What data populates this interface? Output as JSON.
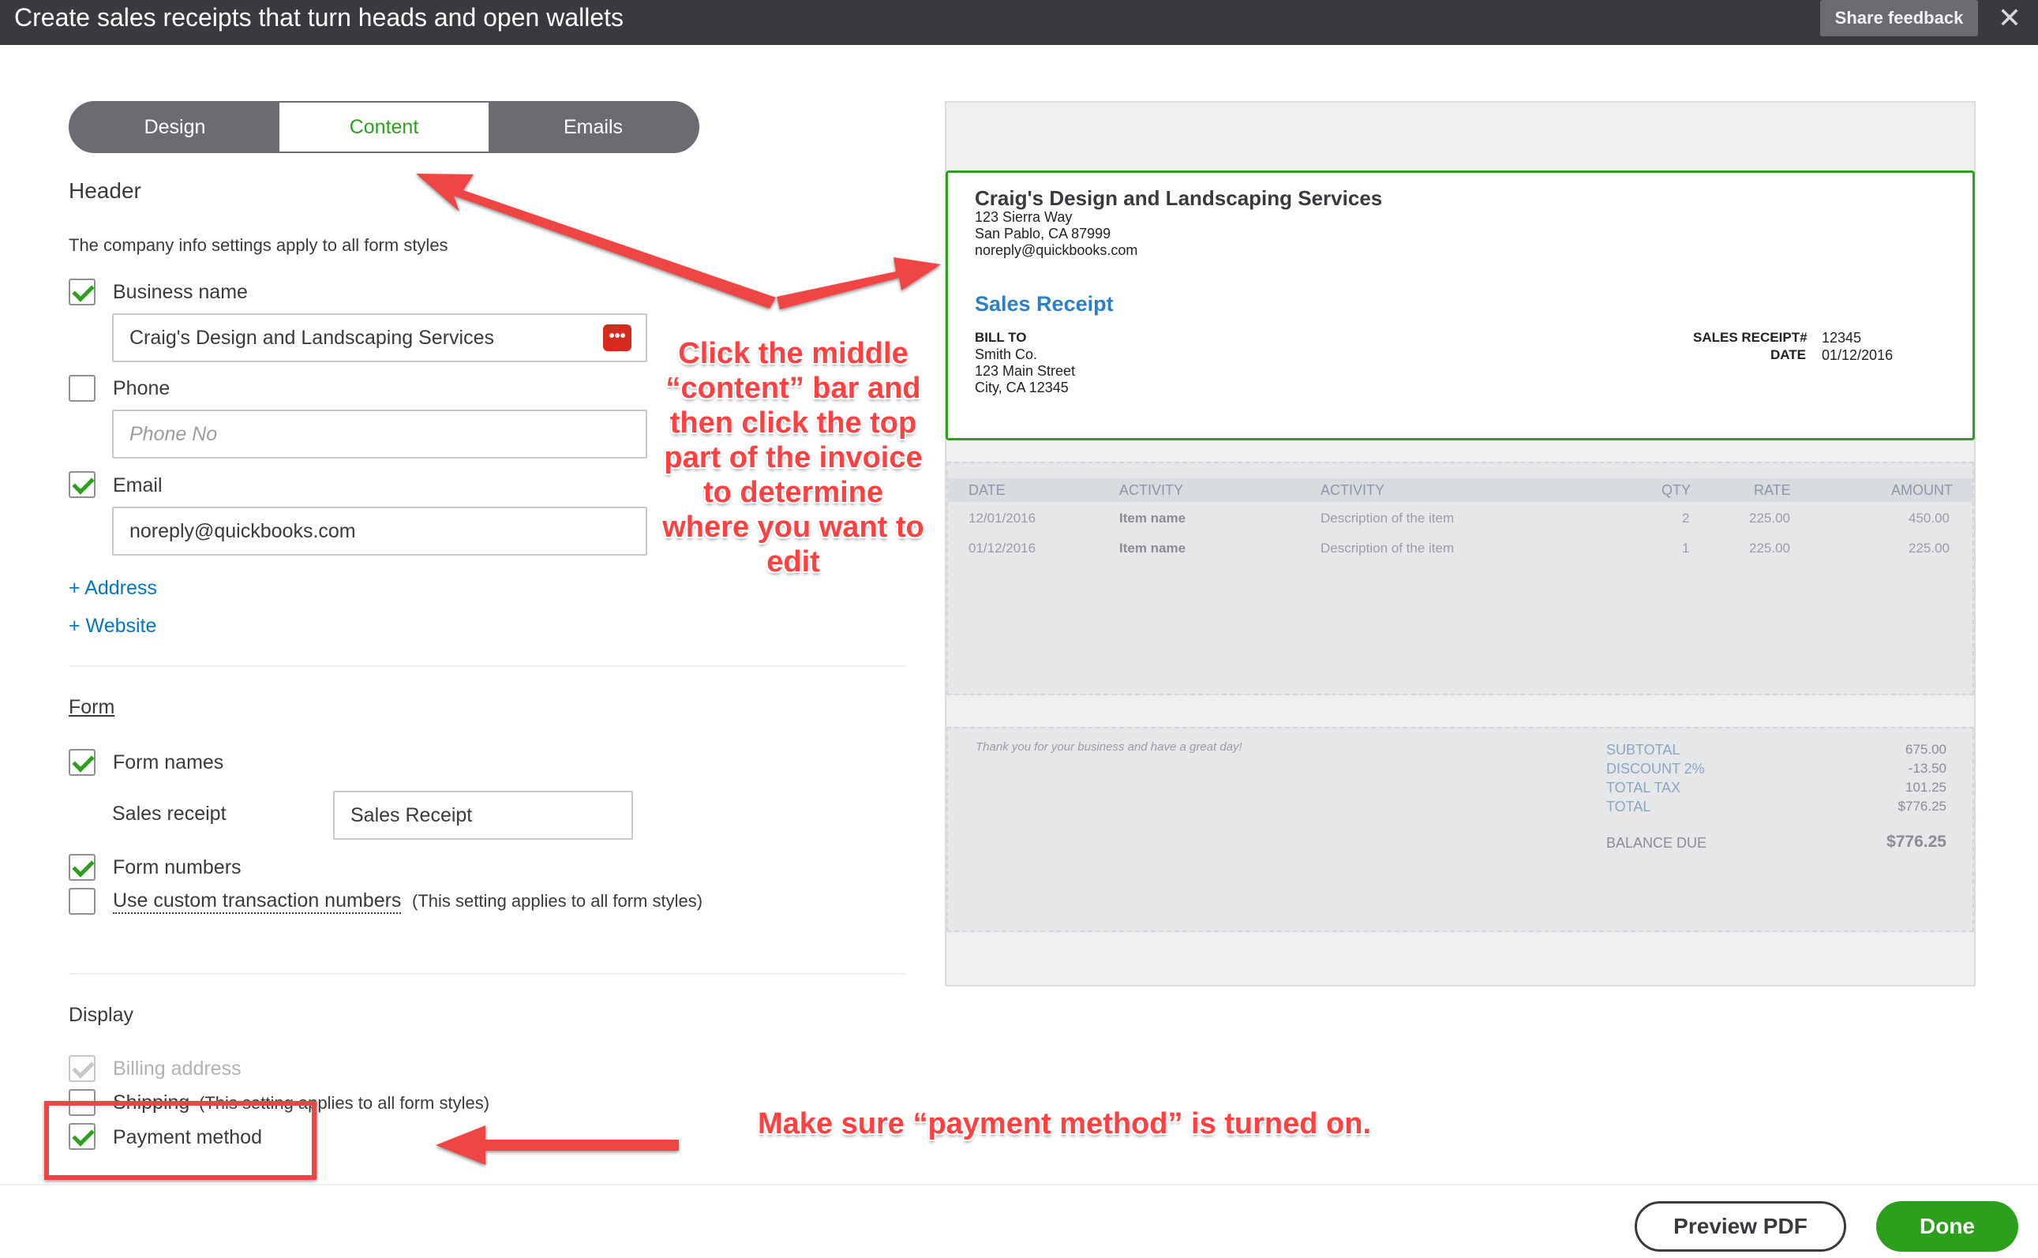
{
  "titlebar": {
    "title": "Create sales receipts that turn heads and open wallets",
    "feedback": "Share feedback",
    "close": "✕"
  },
  "tabs": [
    "Design",
    "Content",
    "Emails"
  ],
  "header_section": {
    "title": "Header",
    "hint": "The company info settings apply to all form styles",
    "business_name_label": "Business name",
    "business_name_value": "Craig's Design and Landscaping Services",
    "phone_label": "Phone",
    "phone_placeholder": "Phone No",
    "email_label": "Email",
    "email_value": "noreply@quickbooks.com",
    "add_address": "+ Address",
    "add_website": "+ Website"
  },
  "form_section": {
    "title": "Form",
    "form_names_label": "Form names",
    "sales_receipt_label": "Sales receipt",
    "sales_receipt_value": "Sales Receipt",
    "form_numbers_label": "Form numbers",
    "custom_numbers_link": "Use custom transaction numbers",
    "custom_numbers_note": "(This setting applies to all form styles)"
  },
  "display_section": {
    "title": "Display",
    "billing_address": "Billing address",
    "shipping": "Shipping",
    "shipping_note": "(This setting applies to all form styles)",
    "payment_method": "Payment method"
  },
  "invoice": {
    "company": "Craig's Design and Landscaping Services",
    "address1": "123 Sierra Way",
    "address2": "San Pablo, CA 87999",
    "email": "noreply@quickbooks.com",
    "title": "Sales Receipt",
    "bill_to_label": "BILL TO",
    "bill_to": [
      "Smith Co.",
      "123 Main Street",
      "City, CA 12345"
    ],
    "receipt_no_label": "SALES RECEIPT#",
    "receipt_no": "12345",
    "date_label": "DATE",
    "date": "01/12/2016",
    "columns": [
      "DATE",
      "ACTIVITY",
      "ACTIVITY",
      "QTY",
      "RATE",
      "AMOUNT"
    ],
    "rows": [
      [
        "12/01/2016",
        "Item name",
        "Description of the item",
        "2",
        "225.00",
        "450.00"
      ],
      [
        "01/12/2016",
        "Item name",
        "Description of the item",
        "1",
        "225.00",
        "225.00"
      ]
    ],
    "thanks": "Thank you for your business and have a great day!",
    "totals": [
      {
        "label": "SUBTOTAL",
        "value": "675.00"
      },
      {
        "label": "DISCOUNT 2%",
        "value": "-13.50"
      },
      {
        "label": "TOTAL TAX",
        "value": "101.25"
      },
      {
        "label": "TOTAL",
        "value": "$776.25"
      }
    ],
    "balance_label": "BALANCE DUE",
    "balance_value": "$776.25"
  },
  "annotations": {
    "middle": [
      "Click the middle",
      "“content” bar and",
      "then click the top",
      "part of the invoice",
      "to determine",
      "where you want to",
      "edit"
    ],
    "bottom": "Make sure “payment method” is turned on."
  },
  "footer": {
    "preview_pdf": "Preview PDF",
    "done": "Done"
  },
  "colors": {
    "accent": "#2ca01c",
    "link": "#0077c5",
    "annotation": "#ff4040",
    "titlebar": "#393a3d"
  }
}
